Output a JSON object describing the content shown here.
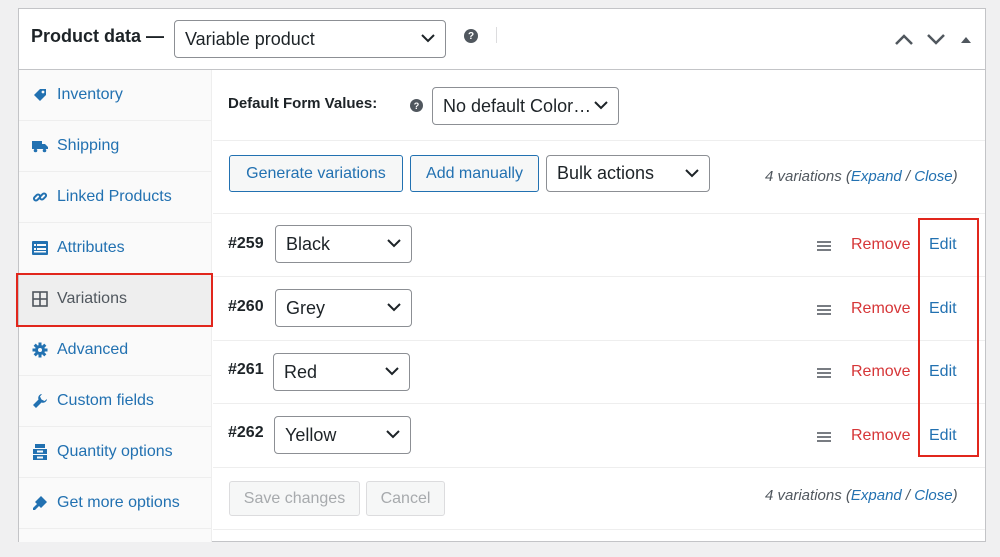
{
  "header": {
    "title": "Product data —",
    "product_type": "Variable product",
    "help_icon": "question-circle-icon",
    "controls": [
      "chevron-up-icon",
      "chevron-down-icon",
      "triangle-up-icon"
    ]
  },
  "sidebar": {
    "items": [
      {
        "label": "Inventory",
        "icon": "tag-icon"
      },
      {
        "label": "Shipping",
        "icon": "truck-icon"
      },
      {
        "label": "Linked Products",
        "icon": "link-icon"
      },
      {
        "label": "Attributes",
        "icon": "list-icon"
      },
      {
        "label": "Variations",
        "icon": "grid-icon"
      },
      {
        "label": "Advanced",
        "icon": "gear-icon"
      },
      {
        "label": "Custom fields",
        "icon": "wrench-icon"
      },
      {
        "label": "Quantity options",
        "icon": "stack-icon"
      },
      {
        "label": "Get more options",
        "icon": "plug-icon"
      }
    ],
    "active": "Variations"
  },
  "defaults": {
    "label": "Default Form Values:",
    "select_value": "No default Color…"
  },
  "toolbar": {
    "generate_label": "Generate variations",
    "add_label": "Add manually",
    "bulk_label": "Bulk actions"
  },
  "count": {
    "text": "4 variations (",
    "expand": "Expand",
    "sep": " / ",
    "close": "Close",
    "end": ")"
  },
  "variations": [
    {
      "id": "#259",
      "value": "Black",
      "remove": "Remove",
      "edit": "Edit"
    },
    {
      "id": "#260",
      "value": "Grey",
      "remove": "Remove",
      "edit": "Edit"
    },
    {
      "id": "#261",
      "value": "Red",
      "remove": "Remove",
      "edit": "Edit"
    },
    {
      "id": "#262",
      "value": "Yellow",
      "remove": "Remove",
      "edit": "Edit"
    }
  ],
  "footer": {
    "save_label": "Save changes",
    "cancel_label": "Cancel"
  },
  "colors": {
    "accent": "#2271b1",
    "remove": "#d63638",
    "highlight": "#e1261c"
  }
}
